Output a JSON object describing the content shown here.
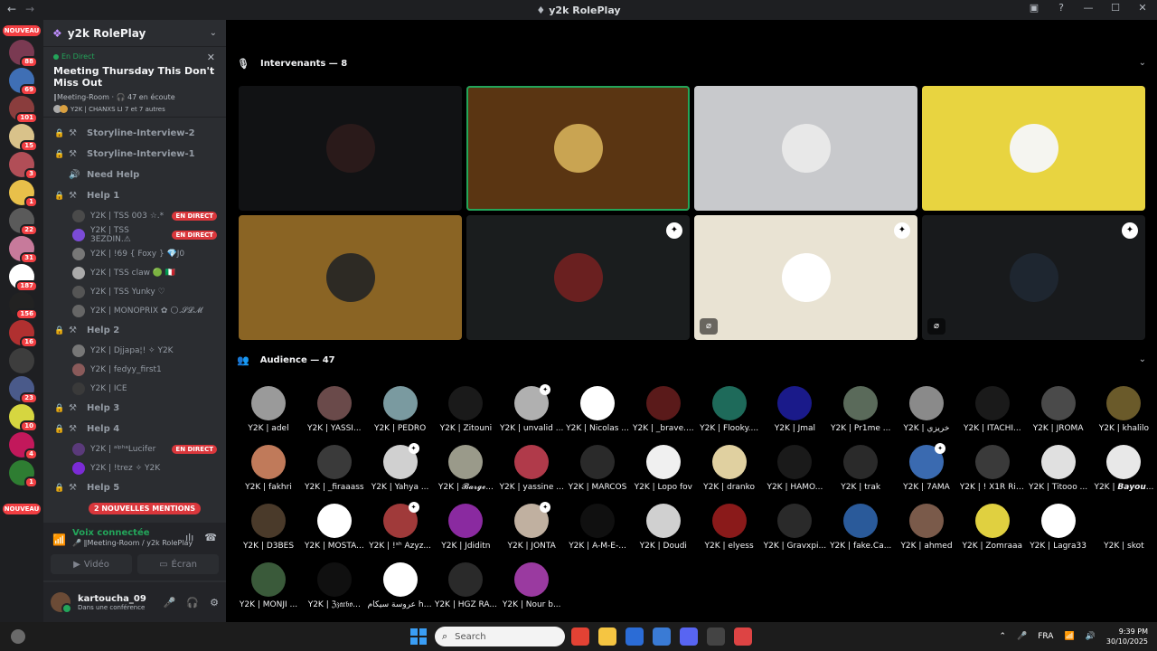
{
  "window": {
    "title": "y2k RolePlay",
    "back": "←",
    "forward": "→",
    "controls": [
      "▣",
      "?",
      "—",
      "☐",
      "✕"
    ]
  },
  "rail": {
    "nouveau_top": "NOUVEAU",
    "nouveau_bottom": "NOUVEAU",
    "servers": [
      {
        "color": "#7a3a52",
        "badge": "88"
      },
      {
        "color": "#3f6fb5",
        "badge": "69"
      },
      {
        "color": "#8a3d3d",
        "badge": "101"
      },
      {
        "color": "#d9c28a",
        "badge": "15"
      },
      {
        "color": "#b14e57",
        "badge": "3"
      },
      {
        "color": "#e8c04a",
        "badge": "1"
      },
      {
        "color": "#5a5a5a",
        "badge": "22"
      },
      {
        "color": "#c77a9b",
        "badge": "31"
      },
      {
        "color": "#ffffff",
        "badge": "187"
      },
      {
        "color": "#222222",
        "badge": "156"
      },
      {
        "color": "#b03030",
        "badge": "16"
      },
      {
        "color": "#3d3d3d",
        "badge": ""
      },
      {
        "color": "#4a5a8a",
        "badge": "23"
      },
      {
        "color": "#d6d640",
        "badge": "10"
      },
      {
        "color": "#c2185b",
        "badge": "4"
      },
      {
        "color": "#2e7d32",
        "badge": "1"
      }
    ]
  },
  "sidebar": {
    "guild_name": "y2k RolePlay",
    "event": {
      "status": "En Direct",
      "title": "Meeting Thursday This Don't Miss Out",
      "location": "∥Meeting-Room · 🎧 47 en écoute",
      "speakers": "Y2K | CHANXS LI 7 et 7 autres"
    },
    "channels": [
      {
        "type": "channel",
        "locked": true,
        "icon": "stage",
        "name": "Storyline-Interview-2"
      },
      {
        "type": "channel",
        "locked": true,
        "icon": "stage",
        "name": "Storyline-Interview-1"
      },
      {
        "type": "channel",
        "locked": false,
        "icon": "voice",
        "name": "Need Help"
      },
      {
        "type": "channel",
        "locked": true,
        "icon": "stage",
        "name": "Help 1"
      },
      {
        "type": "user",
        "name": "Y2K | TSS 003 ☆.*",
        "avatar": "#4a4a4a",
        "live": "EN DIRECT"
      },
      {
        "type": "user",
        "name": "Y2K | TSS 3EZDIN.⚠",
        "avatar": "#7b4bd6",
        "live": "EN DIRECT"
      },
      {
        "type": "user",
        "name": "Y2K | !69 { Foxy } 💎J0",
        "avatar": "#777777",
        "live": ""
      },
      {
        "type": "user",
        "name": "Y2K | TSS claw 🟢 🇮🇹",
        "avatar": "#aaaaaa",
        "live": ""
      },
      {
        "type": "user",
        "name": "Y2K | TSS Yunky ♡",
        "avatar": "#555555",
        "live": ""
      },
      {
        "type": "user",
        "name": "Y2K | MONOPRIX ✿ 🌕.𝓢𝓛𝓜",
        "avatar": "#666666",
        "live": ""
      },
      {
        "type": "channel",
        "locked": true,
        "icon": "stage",
        "name": "Help 2"
      },
      {
        "type": "user",
        "name": "Y2K | Djjapa¦! ✧ Y2K",
        "avatar": "#777777",
        "live": ""
      },
      {
        "type": "user",
        "name": "Y2K | fedyy_first1",
        "avatar": "#8a5a5a",
        "live": ""
      },
      {
        "type": "user",
        "name": "Y2K | ICE",
        "avatar": "#3a3a3a",
        "live": ""
      },
      {
        "type": "channel",
        "locked": true,
        "icon": "stage",
        "name": "Help 3"
      },
      {
        "type": "channel",
        "locked": true,
        "icon": "stage",
        "name": "Help 4"
      },
      {
        "type": "user",
        "name": "Y2K | ᵃˡᵖʰᵃLucifer",
        "avatar": "#5a3a7a",
        "live": "EN DIRECT"
      },
      {
        "type": "user",
        "name": "Y2K | !trez ✧ Y2K",
        "avatar": "#7b2bd6",
        "live": ""
      },
      {
        "type": "channel",
        "locked": true,
        "icon": "stage",
        "name": "Help 5"
      }
    ],
    "mentions_pill": "2 NOUVELLES MENTIONS",
    "voice": {
      "status": "Voix connectée",
      "location": "🎤 ∥Meeting-Room / y2k RolePlay",
      "video_label": "Vidéo",
      "screen_label": "Écran"
    },
    "user": {
      "name": "kartoucha_09",
      "status": "Dans une conférence"
    }
  },
  "stage": {
    "speakers_header": "Intervenants — 8",
    "audience_header": "Audience — 47",
    "speakers": [
      {
        "bg": "#111214",
        "avatar": "#2a1a1a",
        "active": false,
        "badge": false,
        "muted": false
      },
      {
        "bg": "#5a3512",
        "avatar": "#c9a452",
        "active": true,
        "badge": false,
        "muted": false
      },
      {
        "bg": "#c8c9cc",
        "avatar": "#e8e8e8",
        "active": false,
        "badge": false,
        "muted": false
      },
      {
        "bg": "#e8d440",
        "avatar": "#f5f5f0",
        "active": false,
        "badge": false,
        "muted": false
      },
      {
        "bg": "#8a6424",
        "avatar": "#2d2a24",
        "active": false,
        "badge": false,
        "muted": false
      },
      {
        "bg": "#1a1d1e",
        "avatar": "#6a2020",
        "active": false,
        "badge": true,
        "muted": false
      },
      {
        "bg": "#e9e3d3",
        "avatar": "#ffffff",
        "active": false,
        "badge": true,
        "muted": true
      },
      {
        "bg": "#181a1c",
        "avatar": "#1e2630",
        "active": false,
        "badge": true,
        "muted": true
      }
    ],
    "audience": [
      {
        "name": "Y2K | adel",
        "color": "#9a9a9a",
        "mark": false
      },
      {
        "name": "Y2K | YASSI...",
        "color": "#6a4a4a",
        "mark": false
      },
      {
        "name": "Y2K | PEDRO",
        "color": "#7a9aa0",
        "mark": false
      },
      {
        "name": "Y2K | Zitouni",
        "color": "#1a1a1a",
        "mark": false
      },
      {
        "name": "Y2K | unvalid ...",
        "color": "#b0b0b0",
        "mark": true
      },
      {
        "name": "Y2K | Nicolas ...",
        "color": "#ffffff",
        "mark": false
      },
      {
        "name": "Y2K | _brave....",
        "color": "#5a1a1a",
        "mark": false
      },
      {
        "name": "Y2K | Flooky....",
        "color": "#1e6a5a",
        "mark": false
      },
      {
        "name": "Y2K | Jmal",
        "color": "#1a1a8a",
        "mark": false
      },
      {
        "name": "Y2K | Pr1me ...",
        "color": "#5a6a5a",
        "mark": false
      },
      {
        "name": "Y2K | خريزي",
        "color": "#8a8a8a",
        "mark": false
      },
      {
        "name": "Y2K | ITACHI...",
        "color": "#1a1a1a",
        "mark": false
      },
      {
        "name": "Y2K | JROMA",
        "color": "#4a4a4a",
        "mark": false
      },
      {
        "name": "Y2K | khalilo",
        "color": "#6a5a2a",
        "mark": false
      },
      {
        "name": "Y2K | fakhri",
        "color": "#c07a5a",
        "mark": false
      },
      {
        "name": "Y2K | _firaaass",
        "color": "#3a3a3a",
        "mark": false
      },
      {
        "name": "Y2K | Yahya ...",
        "color": "#d0d0d0",
        "mark": true
      },
      {
        "name": "Y2K | 𝓑𝓪𝓻𝓰𝓮...",
        "color": "#9a9a8a",
        "mark": false
      },
      {
        "name": "Y2K | yassine ...",
        "color": "#b03a4a",
        "mark": false
      },
      {
        "name": "Y2K | MARCOS",
        "color": "#2a2a2a",
        "mark": false
      },
      {
        "name": "Y2K | Lopo fov",
        "color": "#f0f0f0",
        "mark": false
      },
      {
        "name": "Y2K | dranko",
        "color": "#e0d0a0",
        "mark": false
      },
      {
        "name": "Y2K | HAMO...",
        "color": "#1a1a1a",
        "mark": false
      },
      {
        "name": "Y2K | trak",
        "color": "#2a2a2a",
        "mark": false
      },
      {
        "name": "Y2K | 7AMA",
        "color": "#3a6ab0",
        "mark": true
      },
      {
        "name": "Y2K | ! X1R Rico",
        "color": "#3a3a3a",
        "mark": false
      },
      {
        "name": "Y2K | Titooo ...",
        "color": "#e0e0e0",
        "mark": false
      },
      {
        "name": "Y2K | 𝘽𝙖𝙮𝙤𝙪...",
        "color": "#e8e8e8",
        "mark": false
      },
      {
        "name": "Y2K | D3BES",
        "color": "#4a3a2a",
        "mark": false
      },
      {
        "name": "Y2K | MOSTA...",
        "color": "#ffffff",
        "mark": false
      },
      {
        "name": "Y2K | !ˢʰ Azyz...",
        "color": "#a03a3a",
        "mark": true
      },
      {
        "name": "Y2K | Jdiditn",
        "color": "#8a2aa0",
        "mark": false
      },
      {
        "name": "Y2K | JONTA",
        "color": "#c0b0a0",
        "mark": true
      },
      {
        "name": "Y2K | A-M-E-...",
        "color": "#101010",
        "mark": false
      },
      {
        "name": "Y2K | Doudi",
        "color": "#d0d0d0",
        "mark": false
      },
      {
        "name": "Y2K | elyess",
        "color": "#8a1a1a",
        "mark": false
      },
      {
        "name": "Y2K | Gravxpi...",
        "color": "#2a2a2a",
        "mark": false
      },
      {
        "name": "Y2K | fake.Ca...",
        "color": "#2a5a9a",
        "mark": false
      },
      {
        "name": "Y2K | ahmed",
        "color": "#7a5a4a",
        "mark": false
      },
      {
        "name": "Y2K | Zomraaa",
        "color": "#e0d040",
        "mark": false
      },
      {
        "name": "Y2K | Lagra33",
        "color": "#ffffff",
        "mark": false
      },
      {
        "name": "Y2K | skot",
        "color": "#000000",
        "mark": false
      },
      {
        "name": "Y2K | MONJI ...",
        "color": "#3a5a3a",
        "mark": false
      },
      {
        "name": "Y2K | ℨ𝔷𝔞𝔯𝔟𝔬...",
        "color": "#101010",
        "mark": false
      },
      {
        "name": "عروسة سيكام hsn...",
        "color": "#ffffff",
        "mark": false
      },
      {
        "name": "Y2K | HGZ RA...",
        "color": "#2a2a2a",
        "mark": false
      },
      {
        "name": "Y2K | Nour b...",
        "color": "#9a3aa0",
        "mark": false
      }
    ]
  },
  "taskbar": {
    "search_placeholder": "Search",
    "language": "FRA",
    "time": "9:39 PM",
    "date": "30/10/2025"
  }
}
